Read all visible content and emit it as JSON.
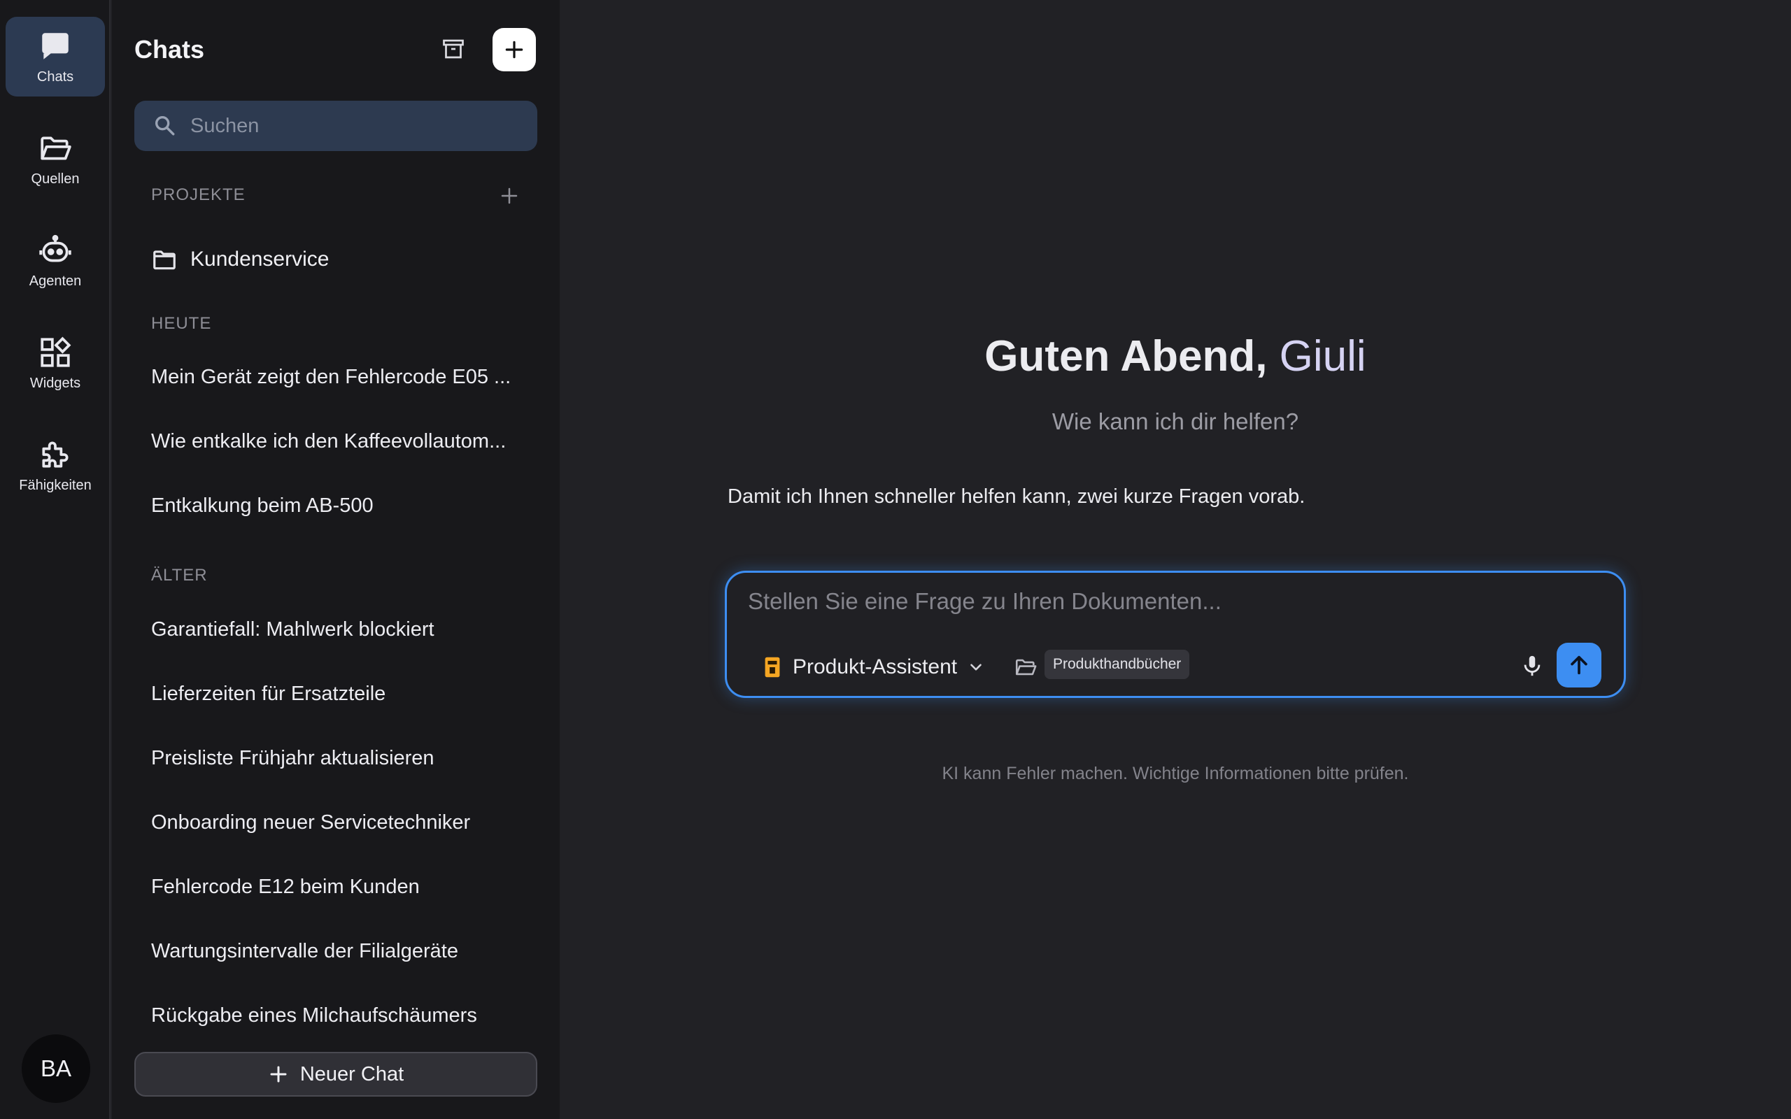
{
  "rail": {
    "items": [
      {
        "label": "Chats",
        "icon": "chat-bubble-icon",
        "active": true
      },
      {
        "label": "Quellen",
        "icon": "folder-open-icon",
        "active": false
      },
      {
        "label": "Agenten",
        "icon": "robot-icon",
        "active": false
      },
      {
        "label": "Widgets",
        "icon": "widgets-icon",
        "active": false
      },
      {
        "label": "Fähigkeiten",
        "icon": "puzzle-icon",
        "active": false
      }
    ],
    "avatar_initials": "BA"
  },
  "sidebar": {
    "title": "Chats",
    "search_placeholder": "Suchen",
    "projects_label": "PROJEKTE",
    "projects": [
      {
        "label": "Kundenservice"
      }
    ],
    "today_label": "HEUTE",
    "today_chats": [
      "Mein Gerät zeigt den Fehlercode E05 ...",
      "Wie entkalke ich den Kaffeevollautom...",
      "Entkalkung beim AB-500"
    ],
    "older_label": "ÄLTER",
    "older_chats": [
      "Garantiefall: Mahlwerk blockiert",
      "Lieferzeiten für Ersatzteile",
      "Preisliste Frühjahr aktualisieren",
      "Onboarding neuer Servicetechniker",
      "Fehlercode E12 beim Kunden",
      "Wartungsintervalle der Filialgeräte",
      "Rückgabe eines Milchaufschäumers"
    ],
    "new_chat_label": "Neuer Chat"
  },
  "main": {
    "greeting_prefix": "Guten Abend, ",
    "greeting_name": "Giuli",
    "subtitle": "Wie kann ich dir helfen?",
    "intro": "Damit ich Ihnen schneller helfen kann, zwei kurze Fragen vorab.",
    "composer": {
      "placeholder": "Stellen Sie eine Frage zu Ihren Dokumenten...",
      "agent_label": "Produkt-Assistent",
      "source_chip": "Produkthandbücher"
    },
    "disclaimer": "KI kann Fehler machen. Wichtige Informationen bitte prüfen."
  },
  "colors": {
    "accent": "#3d8ef2",
    "active_rail": "#2c3a52",
    "agent_icon": "#f5a623"
  }
}
